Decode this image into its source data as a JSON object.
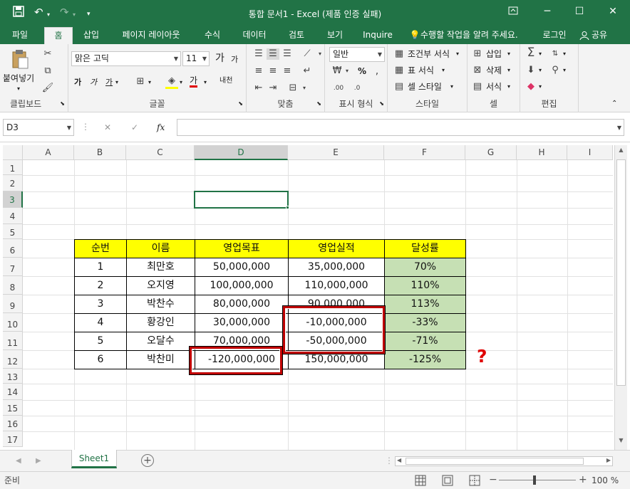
{
  "titlebar": {
    "title": "통합 문서1 - Excel (제품 인증 실패)",
    "restore_icon": "ribbon-display-icon",
    "min": "─",
    "max": "☐",
    "close": "✕"
  },
  "quick_access": {
    "save": "save-icon",
    "undo": "undo-icon",
    "redo": "redo-icon",
    "customize": "customize-icon"
  },
  "tabs": [
    "파일",
    "홈",
    "삽입",
    "페이지 레이아웃",
    "수식",
    "데이터",
    "검토",
    "보기",
    "Inquire"
  ],
  "tell_me": "수행할 작업을 알려 주세요.",
  "login": "로그인",
  "share": "공유",
  "ribbon": {
    "clipboard": {
      "paste": "붙여넣기",
      "label": "클립보드"
    },
    "font": {
      "name": "맑은 고딕",
      "size": "11",
      "label": "글꼴",
      "grow": "가",
      "shrink": "가",
      "bold": "가",
      "italic": "가",
      "underline": "가",
      "fontcolor": "가",
      "phonetic": "내천"
    },
    "align": {
      "label": "맞춤"
    },
    "number": {
      "format": "일반",
      "label": "표시 형식",
      "percent": "%"
    },
    "styles": {
      "cond": "조건부 서식",
      "table": "표 서식",
      "cell": "셀 스타일",
      "label": "스타일"
    },
    "cells": {
      "insert": "삽입",
      "delete": "삭제",
      "format": "서식",
      "label": "셀"
    },
    "editing": {
      "label": "편집"
    }
  },
  "formula_bar": {
    "name_box": "D3",
    "fx": "fx",
    "cancel": "✕",
    "enter": "✓",
    "value": ""
  },
  "columns": [
    "A",
    "B",
    "C",
    "D",
    "E",
    "F",
    "G",
    "H",
    "I"
  ],
  "rows": [
    "1",
    "2",
    "3",
    "4",
    "5",
    "6",
    "7",
    "8",
    "9",
    "10",
    "11",
    "12",
    "13",
    "14",
    "15",
    "16",
    "17"
  ],
  "table": {
    "headers": [
      "순번",
      "이름",
      "영업목표",
      "영업실적",
      "달성률"
    ],
    "rows": [
      [
        "1",
        "최만호",
        "50,000,000",
        "35,000,000",
        "70%"
      ],
      [
        "2",
        "오지영",
        "100,000,000",
        "110,000,000",
        "110%"
      ],
      [
        "3",
        "박찬수",
        "80,000,000",
        "90,000,000",
        "113%"
      ],
      [
        "4",
        "황강인",
        "30,000,000",
        "-10,000,000",
        "-33%"
      ],
      [
        "5",
        "오달수",
        "70,000,000",
        "-50,000,000",
        "-71%"
      ],
      [
        "6",
        "박찬미",
        "-120,000,000",
        "150,000,000",
        "-125%"
      ]
    ]
  },
  "annotation": "?",
  "sheet_tab": "Sheet1",
  "status": {
    "ready": "준비",
    "zoom": "100 %"
  },
  "colors": {
    "excel_green": "#217346",
    "header_yellow": "#ffff00",
    "pct_green": "#c6e0b4",
    "highlight_red": "#c00000"
  }
}
